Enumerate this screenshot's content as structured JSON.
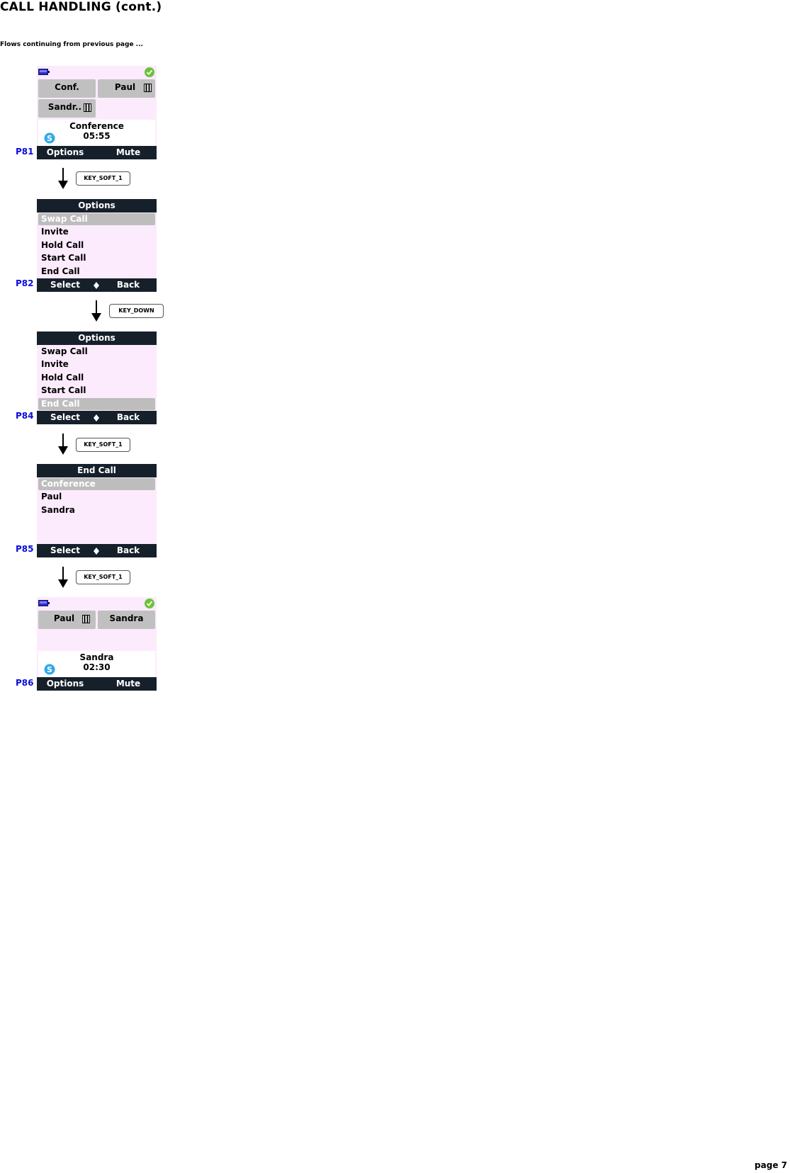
{
  "page": {
    "title": "CALL HANDLING (cont.)",
    "subtitle": "Flows continuing from previous page ...",
    "page_number": "page 7"
  },
  "colors": {
    "screen_bg": "#fcebfc",
    "bar_bg": "#16202a",
    "screen_id": "#0b0bdc",
    "selected_bg": "#bdbdbd",
    "tile_bg": "#c0c0c0"
  },
  "screens": {
    "p81": {
      "id": "P81",
      "tiles": [
        "Conf.",
        "Paul",
        "Sandr.."
      ],
      "info_name": "Conference",
      "info_time": "05:55",
      "softkey_left": "Options",
      "softkey_right": "Mute"
    },
    "p82": {
      "id": "P82",
      "title": "Options",
      "items": [
        "Swap Call",
        "Invite",
        "Hold Call",
        "Start Call",
        "End Call"
      ],
      "selected": "Swap Call",
      "softkey_left": "Select",
      "softkey_right": "Back"
    },
    "p84": {
      "id": "P84",
      "title": "Options",
      "items": [
        "Swap Call",
        "Invite",
        "Hold Call",
        "Start Call",
        "End Call"
      ],
      "selected": "End Call",
      "softkey_left": "Select",
      "softkey_right": "Back"
    },
    "p85": {
      "id": "P85",
      "title": "End Call",
      "items": [
        "Conference",
        "Paul",
        "Sandra"
      ],
      "selected": "Conference",
      "softkey_left": "Select",
      "softkey_right": "Back"
    },
    "p86": {
      "id": "P86",
      "tiles": [
        "Paul",
        "Sandra"
      ],
      "info_name": "Sandra",
      "info_time": "02:30",
      "softkey_left": "Options",
      "softkey_right": "Mute"
    }
  },
  "transitions": [
    {
      "key": "KEY_SOFT_1",
      "from": "P81",
      "to": "P82"
    },
    {
      "key": "KEY_DOWN",
      "from": "P82",
      "to": "P84"
    },
    {
      "key": "KEY_SOFT_1",
      "from": "P84",
      "to": "P85"
    },
    {
      "key": "KEY_SOFT_1",
      "from": "P85",
      "to": "P86"
    }
  ],
  "icons": {
    "battery": "battery-icon",
    "status_ok": "check-icon",
    "hold": "hold-icon",
    "skype": "skype-icon",
    "nav": "up-down-nav-icon",
    "arrow": "arrow-down-icon"
  }
}
